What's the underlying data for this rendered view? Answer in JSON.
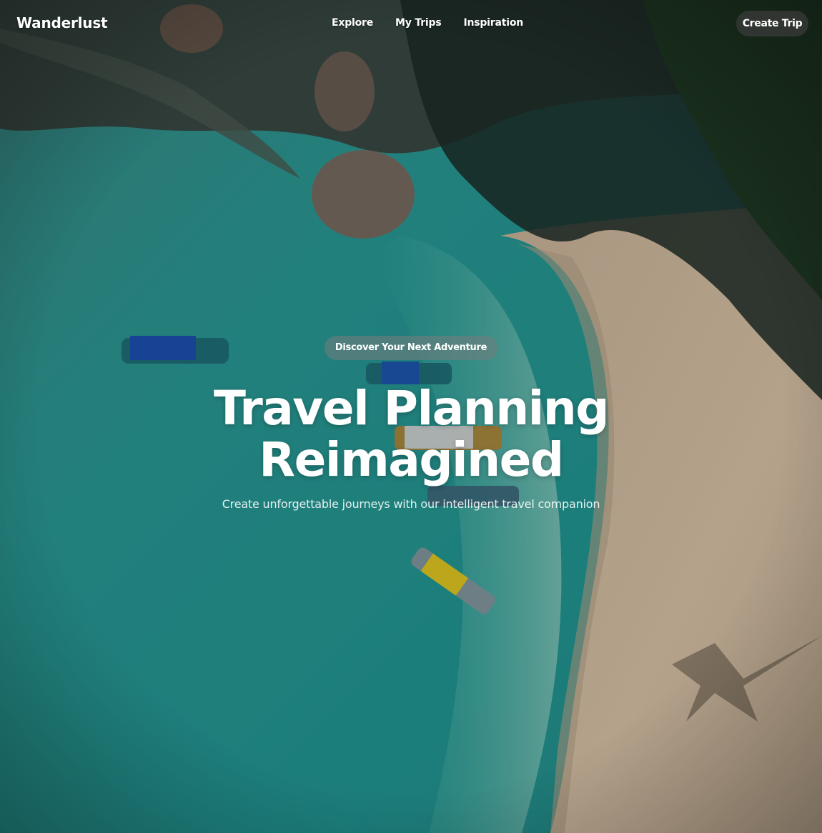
{
  "brand": {
    "name": "Wanderlust"
  },
  "nav": {
    "links": [
      "Explore",
      "My Trips",
      "Inspiration"
    ],
    "cta_label": "Create Trip"
  },
  "hero": {
    "badge": "Discover Your Next Adventure",
    "title_line1": "Travel Planning",
    "title_line2": "Reimagined",
    "subtitle": "Create unforgettable journeys with our intelligent travel companion",
    "background": "aerial-beach-photo"
  },
  "colors": {
    "water": "#2aa9a2",
    "sand": "#d9c2a6",
    "text": "#ffffff",
    "button_bg": "#3c3c3c"
  }
}
